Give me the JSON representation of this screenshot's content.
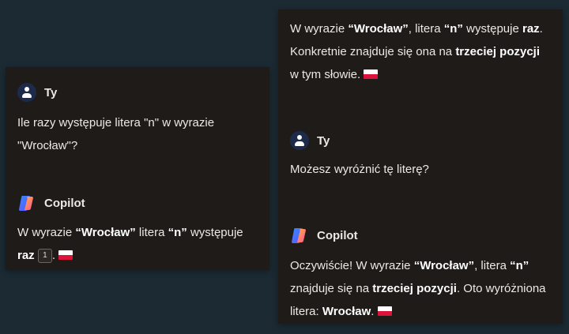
{
  "left_panel": {
    "user": {
      "name": "Ty",
      "message": "Ile razy występuje litera \"n\" w wyrazie \"Wrocław\"?"
    },
    "copilot": {
      "name": "Copilot",
      "msg_prefix": "W wyrazie ",
      "msg_word": "“Wrocław”",
      "msg_mid": " litera ",
      "msg_letter": "“n”",
      "msg_verb": " występuje ",
      "msg_count": "raz",
      "citation": "1",
      "msg_end": "."
    }
  },
  "right_panel": {
    "copilot_top": {
      "p1": "W wyrazie ",
      "b1": "“Wrocław”",
      "p2": ", litera ",
      "b2": "“n”",
      "p3": " występuje ",
      "b3": "raz",
      "p4": ". Konkretnie znajduje się ona na ",
      "b4": "trzeciej pozycji",
      "p5": " w tym słowie. "
    },
    "user": {
      "name": "Ty",
      "message": "Możesz wyróżnić tę literę?"
    },
    "copilot": {
      "name": "Copilot",
      "p1": "Oczywiście! W wyrazie ",
      "b1": "“Wrocław”",
      "p2": ", litera ",
      "b2": "“n”",
      "p3": " znajduje się na ",
      "b3": "trzeciej pozycji",
      "p4": ". Oto wyróżniona litera: ",
      "b4": "Wrocław",
      "p5": ". "
    }
  },
  "icons": {
    "user_avatar": "person-icon",
    "copilot_logo": "copilot-logo-icon",
    "flag": "poland-flag-icon"
  }
}
